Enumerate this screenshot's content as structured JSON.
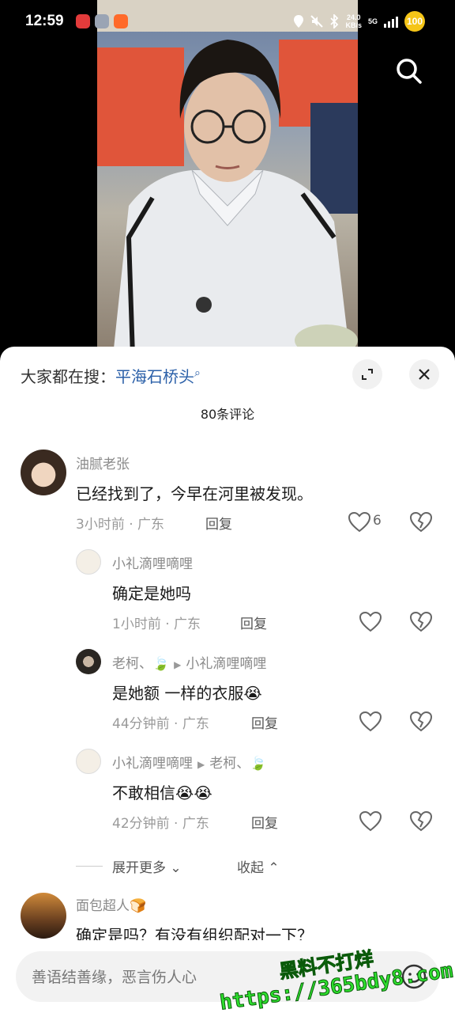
{
  "status_bar": {
    "time": "12:59",
    "net_speed_value": "24.0",
    "net_speed_unit": "KB/s",
    "net_type": "5G",
    "battery": "100"
  },
  "sheet": {
    "search_prefix": "大家都在搜：",
    "search_keyword": "平海石桥头",
    "comment_count": "80条评论"
  },
  "comments": [
    {
      "user": "油腻老张",
      "text": "已经找到了，今早在河里被发现。",
      "meta": "3小时前 · 广东",
      "reply_label": "回复",
      "likes": "6"
    },
    {
      "user": "小礼滴哩嘀哩",
      "text": "确定是她吗",
      "meta": "1小时前 · 广东",
      "reply_label": "回复"
    },
    {
      "user": "老柯、🍃",
      "reply_to": "小礼滴哩嘀哩",
      "text": "是她额  一样的衣服😭",
      "meta": "44分钟前 · 广东",
      "reply_label": "回复"
    },
    {
      "user": "小礼滴哩嘀哩",
      "reply_to": "老柯、🍃",
      "text": "不敢相信😭😭",
      "meta": "42分钟前 · 广东",
      "reply_label": "回复"
    },
    {
      "user": "面包超人🍞",
      "text": "确定是吗？有没有组织配对一下？"
    }
  ],
  "thread_controls": {
    "expand_more": "展开更多 ⌄",
    "collapse": "收起 ⌃"
  },
  "input": {
    "placeholder": "善语结善缘，恶言伤人心"
  },
  "watermark": {
    "line1": "黑料不打烊",
    "line2": "https://365bdy8.com"
  },
  "icons": {
    "search": "search-icon",
    "expand": "expand-icon",
    "close": "close-icon",
    "like": "heart-outline-icon",
    "dislike": "broken-heart-icon",
    "emoji": "smiley-icon"
  }
}
